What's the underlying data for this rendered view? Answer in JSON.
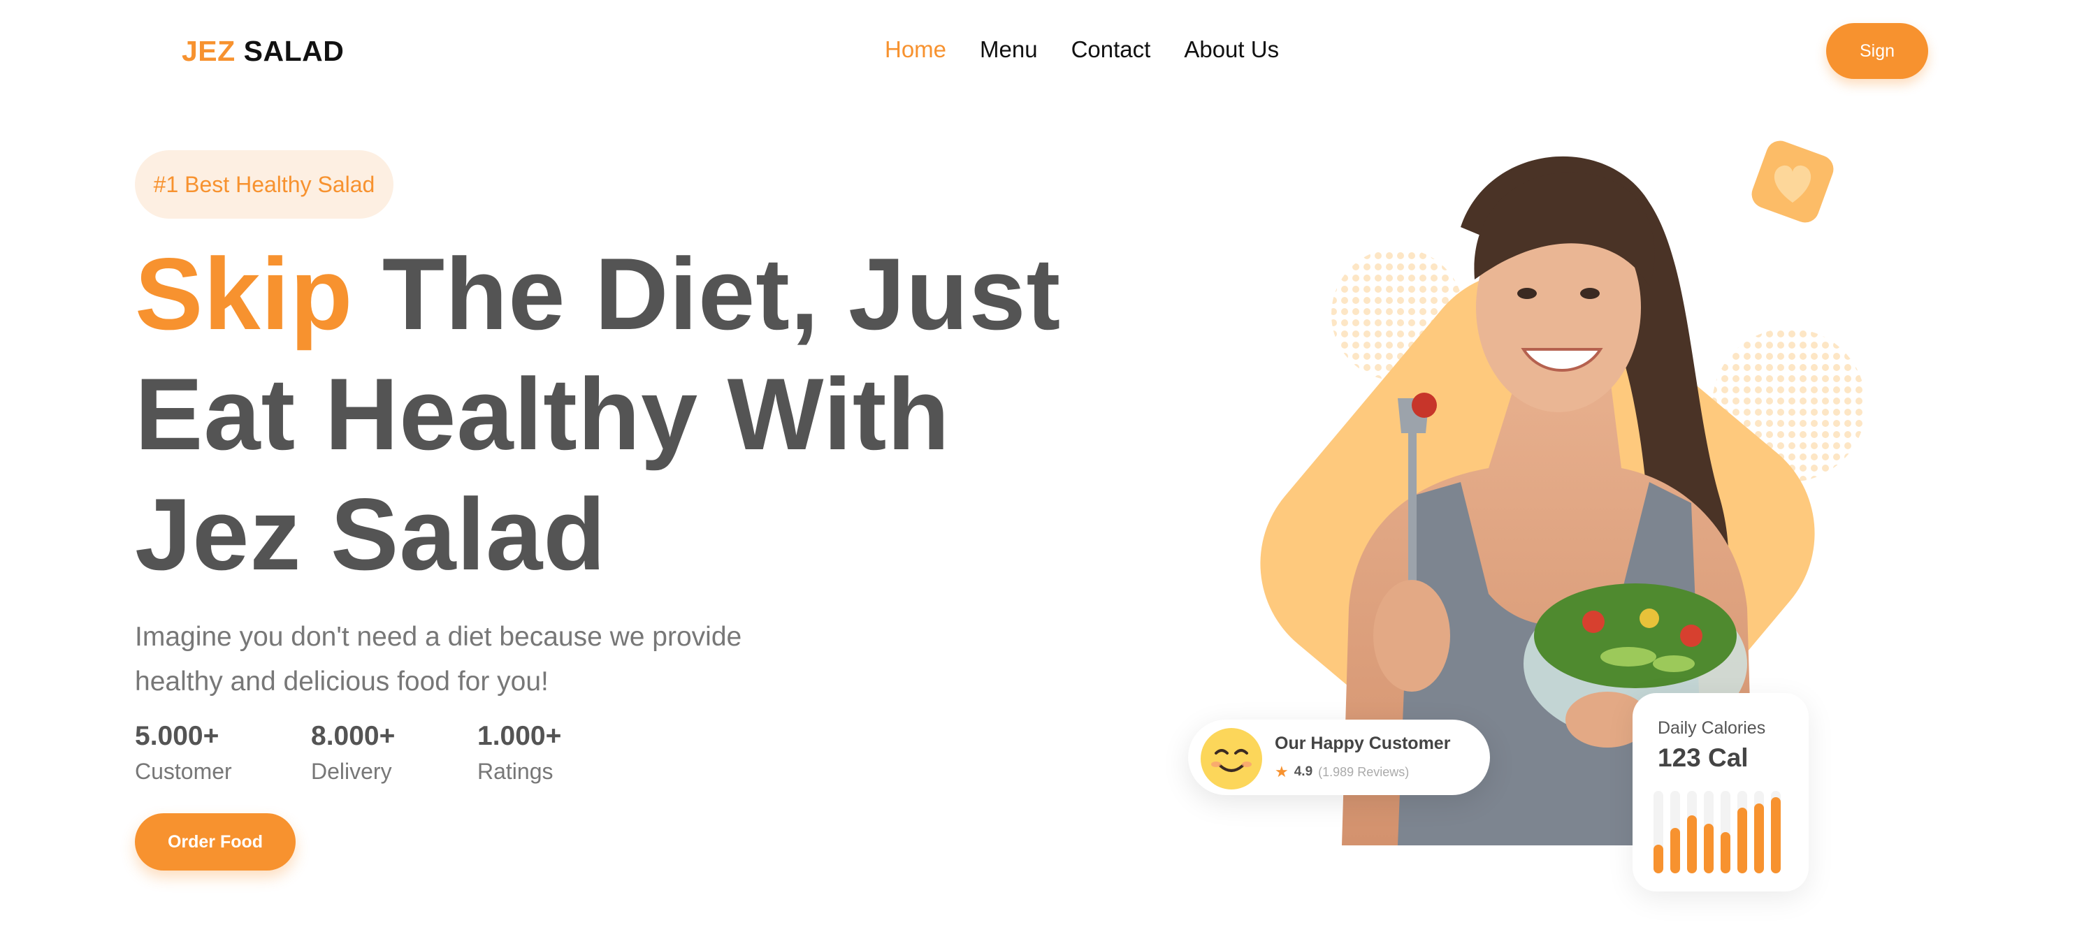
{
  "nav": {
    "logo_accent": "JEZ",
    "logo_main": "SALAD",
    "items": [
      {
        "label": "Home",
        "active": true
      },
      {
        "label": "Menu",
        "active": false
      },
      {
        "label": "Contact",
        "active": false
      },
      {
        "label": "About Us",
        "active": false
      }
    ],
    "sign_label": "Sign"
  },
  "hero": {
    "badge": "#1 Best Healthy Salad",
    "headline_accent": "Skip",
    "headline_rest_1": "The Diet, Just",
    "headline_line_2": "Eat Healthy With",
    "headline_line_3": "Jez Salad",
    "subtext_line_1": "Imagine you don't need a diet because we provide",
    "subtext_line_2": "healthy and delicious food for you!",
    "order_label": "Order Food"
  },
  "stats": [
    {
      "value": "5.000+",
      "label": "Customer"
    },
    {
      "value": "8.000+",
      "label": "Delivery"
    },
    {
      "value": "1.000+",
      "label": "Ratings"
    }
  ],
  "customer_card": {
    "title": "Our Happy Customer",
    "score": "4.9",
    "reviews": "(1.989 Reviews)"
  },
  "calories_card": {
    "title": "Daily Calories",
    "value": "123 Cal",
    "bar_levels": [
      0.35,
      0.55,
      0.7,
      0.6,
      0.5,
      0.8,
      0.85,
      0.92
    ]
  },
  "colors": {
    "accent": "#f7922f",
    "accent_light": "#fdefe2",
    "blob": "#fec97d",
    "heading": "#545454"
  },
  "icons": {
    "heart": "heart-icon",
    "star": "star-icon",
    "smiley": "smiley-icon"
  }
}
